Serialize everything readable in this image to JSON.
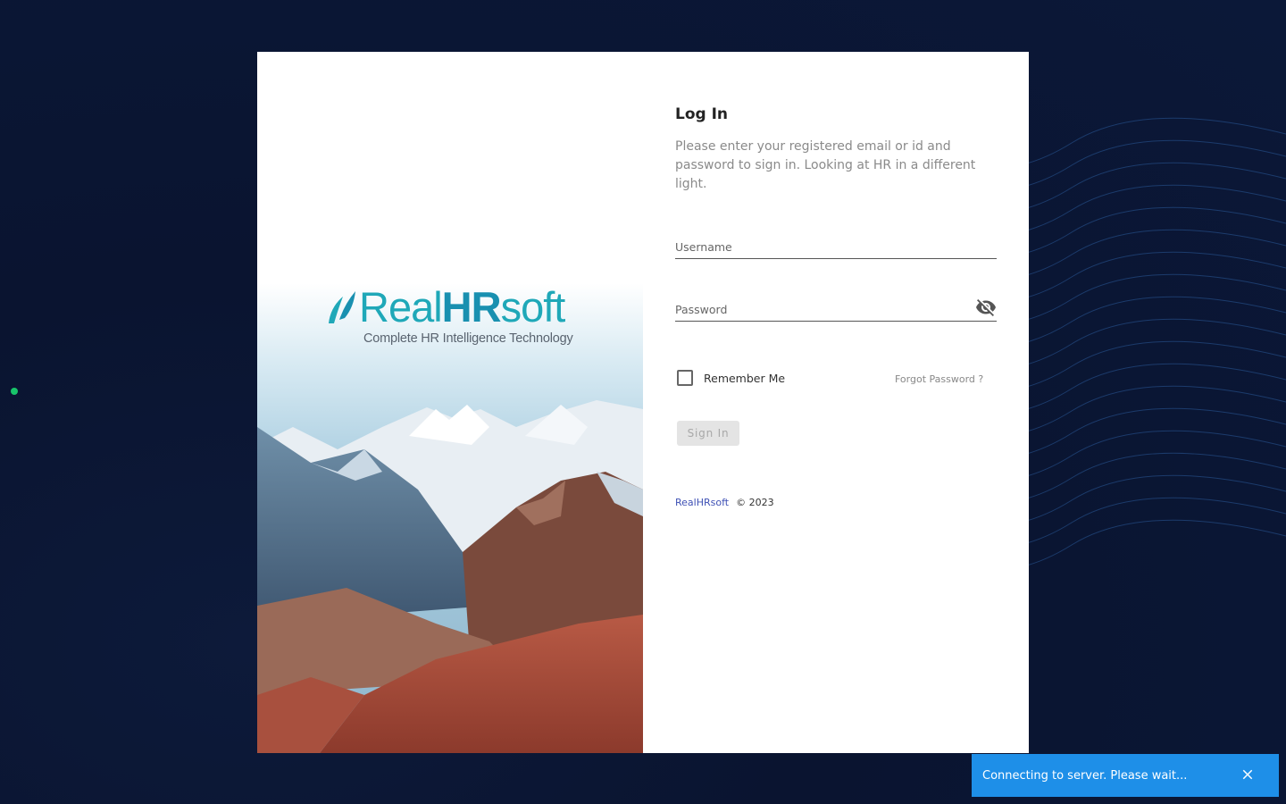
{
  "brand": {
    "name_part1": "Real",
    "name_part2": "HR",
    "name_part3": "soft",
    "tagline": "Complete HR Intelligence Technology",
    "brand_color": "#1fa8b8"
  },
  "login": {
    "title": "Log In",
    "subtitle": "Please enter your registered email or id and password to sign in. Looking at HR in a different light.",
    "username_placeholder": "Username",
    "password_placeholder": "Password",
    "remember_label": "Remember Me",
    "forgot_label": "Forgot Password ?",
    "signin_label": "Sign In"
  },
  "footer": {
    "link": "RealHRsoft",
    "copyright": "© 2023"
  },
  "toast": {
    "message": "Connecting to server. Please wait...",
    "color": "#1e8fe8"
  },
  "icons": {
    "visibility": "visibility-off-icon",
    "close": "close-icon",
    "logo": "leaf-logo-icon"
  }
}
